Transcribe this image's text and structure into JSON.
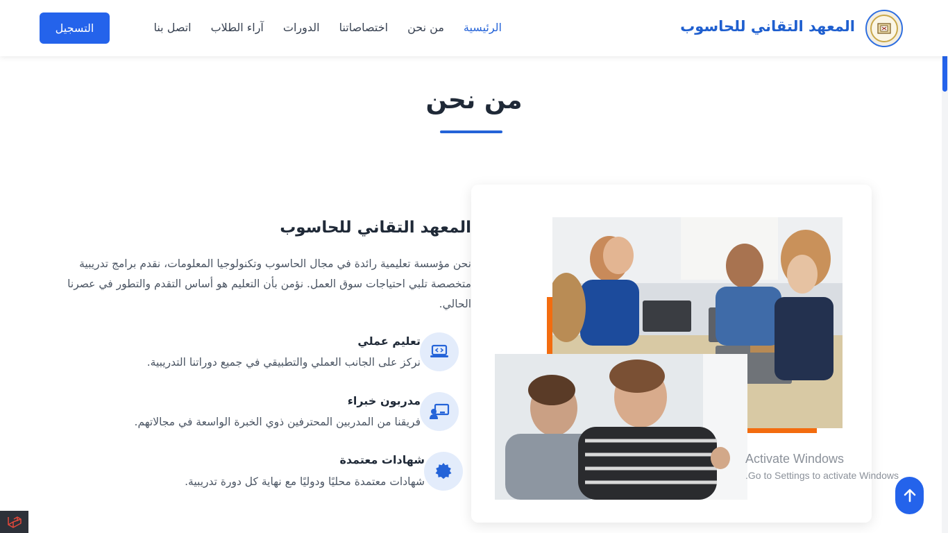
{
  "header": {
    "brand": "المعهد التقاني للحاسوب",
    "nav": [
      {
        "label": "الرئيسية",
        "active": true
      },
      {
        "label": "من نحن",
        "active": false
      },
      {
        "label": "اختصاصاتنا",
        "active": false
      },
      {
        "label": "الدورات",
        "active": false
      },
      {
        "label": "آراء الطلاب",
        "active": false
      },
      {
        "label": "اتصل بنا",
        "active": false
      }
    ],
    "register_label": "التسجيل"
  },
  "about": {
    "section_title": "من نحن",
    "heading": "المعهد التقاني للحاسوب",
    "description": "نحن مؤسسة تعليمية رائدة في مجال الحاسوب وتكنولوجيا المعلومات، نقدم برامج تدريبية متخصصة تلبي احتياجات سوق العمل. نؤمن بأن التعليم هو أساس التقدم والتطور في عصرنا الحالي.",
    "features": [
      {
        "title": "تعليم عملي",
        "text": "نركز على الجانب العملي والتطبيقي في جميع دوراتنا التدريبية.",
        "icon": "laptop-code-icon"
      },
      {
        "title": "مدربون خبراء",
        "text": "فريقنا من المدربين المحترفين ذوي الخبرة الواسعة في مجالاتهم.",
        "icon": "teacher-icon"
      },
      {
        "title": "شهادات معتمدة",
        "text": "شهادات معتمدة محليًا ودوليًا مع نهاية كل دورة تدريبية.",
        "icon": "certificate-icon"
      }
    ]
  },
  "watermark": {
    "title": "Activate Windows",
    "subtitle": "Go to Settings to activate Windows."
  },
  "colors": {
    "primary": "#2463eb",
    "accent_orange": "#f36c0f",
    "icon_bg": "#e3ecfb"
  }
}
